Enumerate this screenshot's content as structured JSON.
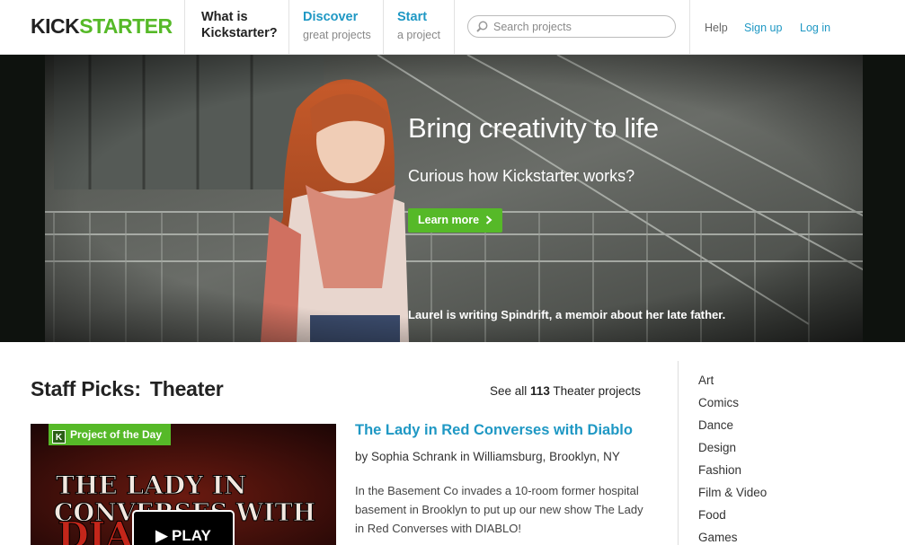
{
  "header": {
    "logo_part1": "KICK",
    "logo_part2": "STARTER",
    "what_is_line1": "What is",
    "what_is_line2": "Kickstarter?",
    "discover_title": "Discover",
    "discover_sub": "great projects",
    "start_title": "Start",
    "start_sub": "a project",
    "search_placeholder": "Search projects",
    "help": "Help",
    "signup": "Sign up",
    "login": "Log in"
  },
  "hero": {
    "title": "Bring creativity to life",
    "subtitle": "Curious how Kickstarter works?",
    "button": "Learn more",
    "button_icon": "chevron-right-icon",
    "caption": "Laurel is writing Spindrift, a memoir about her late father."
  },
  "staff_picks": {
    "label": "Staff Picks:",
    "category": "Theater",
    "see_all_prefix": "See all",
    "see_all_count": "113",
    "see_all_suffix": "Theater projects"
  },
  "featured": {
    "badge": "Project of the Day",
    "badge_icon": "K",
    "video_text_line1": "THE LADY IN",
    "video_text_line2": "CONVERSES WITH",
    "video_text_line3": "DIABLO",
    "play_label": "PLAY",
    "title": "The Lady in Red Converses with Diablo",
    "byline": "by Sophia Schrank in Williamsburg, Brooklyn, NY",
    "description": "In the Basement Co invades a 10-room former hospital basement in Brooklyn to put up our new show The Lady in Red Converses with DIABLO!"
  },
  "categories": [
    "Art",
    "Comics",
    "Dance",
    "Design",
    "Fashion",
    "Film & Video",
    "Food",
    "Games"
  ],
  "colors": {
    "brand_green": "#56b928",
    "link_blue": "#1f98c4"
  }
}
